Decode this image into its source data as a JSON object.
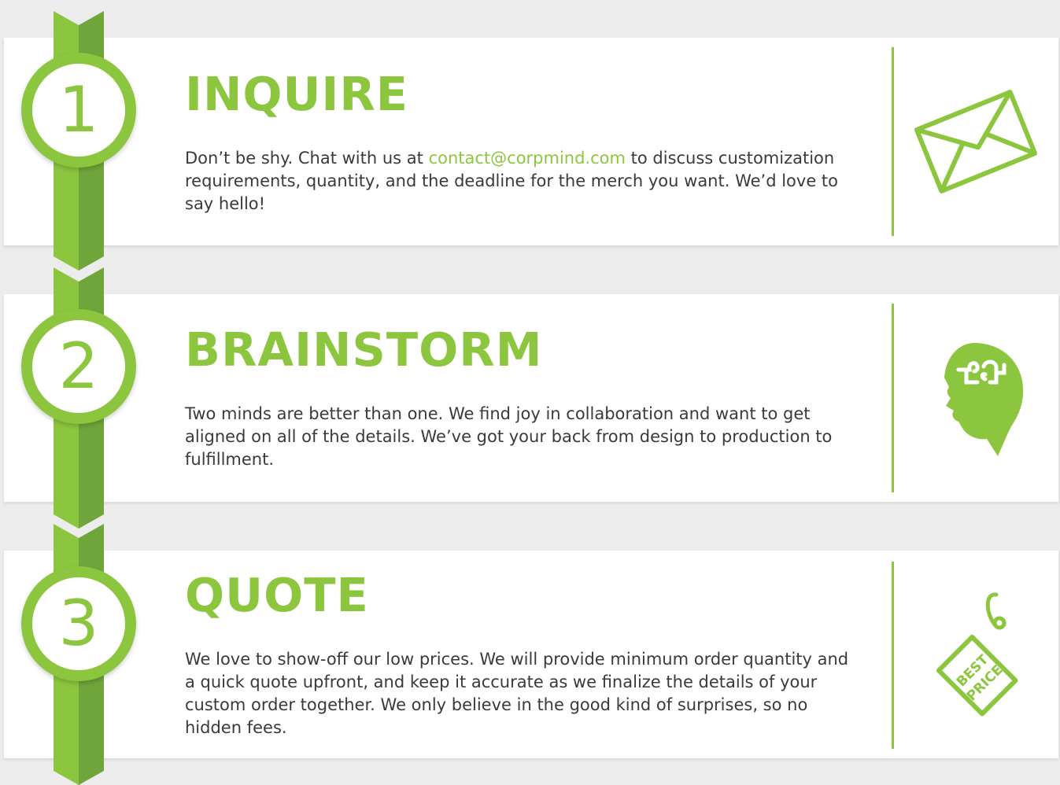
{
  "steps": [
    {
      "number": "1",
      "title": "INQUIRE",
      "text_before_link": "Don’t be shy. Chat with us at ",
      "link": "contact@corpmind.com",
      "text_after_link": " to discuss customization requirements, quantity, and the deadline for the merch you want. We’d love to say hello!",
      "icon": "envelope-icon"
    },
    {
      "number": "2",
      "title": "BRAINSTORM",
      "text": "Two minds are better than one. We find joy in collaboration and want to get aligned on all of the details. We’ve got your back from design to production to fulfillment.",
      "icon": "head-puzzle-icon"
    },
    {
      "number": "3",
      "title": "QUOTE",
      "text": "We love to show-off our low prices. We will provide minimum order quantity and a quick quote upfront, and keep it accurate as we finalize the details of your custom order together. We only believe in the good kind of surprises, so no hidden fees.",
      "icon": "price-tag-icon",
      "tag_text": [
        "BEST",
        "PRICE"
      ]
    }
  ],
  "colors": {
    "accent": "#8cc63f",
    "accent_dark": "#6fa53a",
    "text": "#3a3a3a",
    "background": "#ececec",
    "card": "#ffffff"
  }
}
